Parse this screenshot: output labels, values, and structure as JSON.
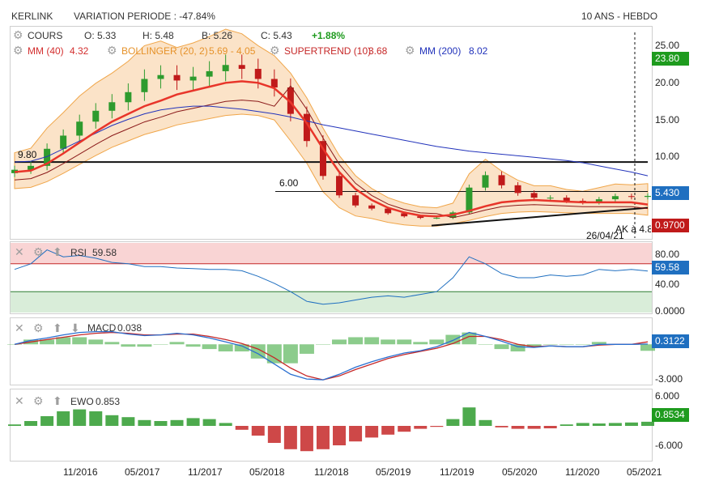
{
  "header": {
    "ticker": "KERLINK",
    "variation": "VARIATION PERIODE : -47.84%",
    "period": "10 ANS - HEBDO"
  },
  "legend": {
    "cours": "COURS",
    "open": "O: 5.33",
    "high": "H: 5.48",
    "low": "B: 5.26",
    "close": "C: 5.43",
    "change": "+1.88%",
    "mm40": "MM (40)",
    "mm40_val": "4.32",
    "bollinger": "BOLLINGER (20, 2)",
    "bollinger_val": "5.69 - 4.05",
    "supertrend": "SUPERTREND (10)",
    "supertrend_val": "3.68",
    "mm200": "MM (200)",
    "mm200_val": "8.02"
  },
  "annotations": {
    "level_high": "9.80",
    "level_mid": "6.00",
    "date_mark": "26/04/21",
    "ak": "AK à 4.80"
  },
  "badges": {
    "top": "23.80",
    "price": "5.430",
    "low": "0.9700",
    "rsi": "59.58",
    "macd": "0.3122",
    "ewo": "0.8534"
  },
  "colors": {
    "up": "#2e9b2e",
    "down": "#c01a1a",
    "mm40": "#e8352a",
    "mm200": "#2233bb",
    "bollinger_fill": "#fbe3c8",
    "bollinger_line": "#f0a64a",
    "supertrend": "#8b1a1a",
    "rsi": "#1f6fc0",
    "macd_line": "#2a6fd0",
    "signal_line": "#c62828",
    "hist": "#66bb66",
    "ewo_neg": "#c62828",
    "badge_green": "#1e9b1e",
    "badge_blue": "#1f6fc0",
    "badge_red": "#c01a1a"
  },
  "chart_data": [
    {
      "type": "candlestick",
      "name": "COURS",
      "y_ticks": [
        "25.00",
        "20.00",
        "15.00",
        "10.00"
      ],
      "ylim": [
        0,
        26.5
      ],
      "x_ticks": [
        "11/2016",
        "05/2017",
        "11/2017",
        "05/2018",
        "11/2018",
        "05/2019",
        "11/2019",
        "05/2020",
        "11/2020",
        "05/2021"
      ],
      "close": [
        8.8,
        9.3,
        11.5,
        13.2,
        15.0,
        16.4,
        17.5,
        18.8,
        20.5,
        21.0,
        20.3,
        20.8,
        21.5,
        22.3,
        21.8,
        20.5,
        19.4,
        16.0,
        12.5,
        8.0,
        5.5,
        4.2,
        3.8,
        3.2,
        2.8,
        2.6,
        2.6,
        3.3,
        6.5,
        8.1,
        6.8,
        5.8,
        5.2,
        5.2,
        4.8,
        4.6,
        5.0,
        5.4,
        5.3,
        5.43
      ],
      "mm40": [
        8.5,
        8.7,
        9.6,
        10.9,
        12.3,
        13.7,
        15.0,
        16.0,
        17.0,
        17.7,
        18.5,
        19.0,
        19.5,
        20.0,
        20.2,
        20.0,
        19.3,
        17.5,
        14.8,
        11.5,
        8.5,
        6.3,
        4.9,
        3.9,
        3.3,
        2.9,
        2.8,
        3.0,
        3.5,
        4.1,
        4.6,
        4.8,
        4.9,
        4.8,
        4.7,
        4.6,
        4.6,
        4.6,
        4.6,
        4.32
      ],
      "mm200": [
        9.8,
        9.9,
        10.5,
        11.5,
        12.5,
        13.5,
        14.5,
        15.3,
        16.0,
        16.5,
        16.8,
        17.0,
        17.0,
        16.8,
        16.6,
        16.3,
        16.0,
        15.6,
        15.1,
        14.6,
        14.2,
        13.8,
        13.4,
        13.0,
        12.6,
        12.2,
        11.8,
        11.5,
        11.2,
        11.0,
        10.8,
        10.6,
        10.4,
        10.2,
        10.0,
        9.7,
        9.3,
        8.9,
        8.5,
        8.02
      ],
      "levels": [
        9.8,
        6.0
      ]
    },
    {
      "type": "line",
      "name": "RSI",
      "value_label": "59.58",
      "y_ticks": [
        "80.00",
        "40.00",
        "0.0000"
      ],
      "ylim": [
        0,
        100
      ],
      "zones": [
        70,
        30
      ],
      "values": [
        62,
        70,
        90,
        80,
        82,
        78,
        72,
        70,
        66,
        66,
        64,
        63,
        62,
        62,
        60,
        52,
        42,
        30,
        16,
        12,
        14,
        18,
        22,
        24,
        22,
        26,
        30,
        50,
        80,
        70,
        56,
        50,
        50,
        54,
        52,
        54,
        62,
        60,
        62,
        59.58
      ]
    },
    {
      "type": "line",
      "name": "MACD",
      "value_label": "0.038",
      "y_ticks": [
        "-3.000"
      ],
      "ylim": [
        -5,
        3
      ],
      "macd": [
        0.0,
        0.5,
        0.8,
        1.2,
        1.5,
        1.6,
        1.6,
        1.3,
        1.1,
        1.2,
        1.4,
        1.2,
        0.8,
        0.3,
        -0.2,
        -1.2,
        -2.5,
        -3.8,
        -4.4,
        -4.5,
        -3.8,
        -2.9,
        -2.2,
        -1.6,
        -1.1,
        -0.8,
        -0.3,
        0.5,
        1.5,
        1.0,
        0.4,
        -0.3,
        -0.4,
        -0.2,
        -0.3,
        -0.3,
        0.0,
        0.0,
        0.0,
        0.038
      ],
      "signal": [
        0.0,
        0.3,
        0.6,
        0.9,
        1.2,
        1.4,
        1.5,
        1.4,
        1.2,
        1.2,
        1.3,
        1.3,
        1.0,
        0.6,
        0.1,
        -0.6,
        -1.7,
        -3.0,
        -4.0,
        -4.5,
        -4.0,
        -3.2,
        -2.5,
        -1.8,
        -1.3,
        -0.9,
        -0.5,
        0.1,
        1.0,
        1.0,
        0.6,
        0.0,
        -0.3,
        -0.2,
        -0.3,
        -0.3,
        -0.1,
        0.0,
        0.0,
        0.3122
      ]
    },
    {
      "type": "bar",
      "name": "EWO",
      "value_label": "0.853",
      "y_ticks": [
        "6.000",
        "-6.000"
      ],
      "ylim": [
        -7,
        7
      ],
      "values": [
        0.3,
        1.0,
        2.0,
        3.0,
        3.4,
        3.0,
        2.2,
        1.8,
        1.2,
        1.0,
        1.2,
        1.6,
        1.4,
        0.6,
        -0.8,
        -2.0,
        -3.5,
        -4.8,
        -5.2,
        -4.8,
        -4.0,
        -3.2,
        -2.4,
        -1.8,
        -1.2,
        -0.6,
        -0.2,
        1.4,
        3.8,
        1.2,
        -0.3,
        -0.6,
        -0.6,
        -0.5,
        0.3,
        0.6,
        0.5,
        0.6,
        0.7,
        0.8534
      ]
    }
  ]
}
